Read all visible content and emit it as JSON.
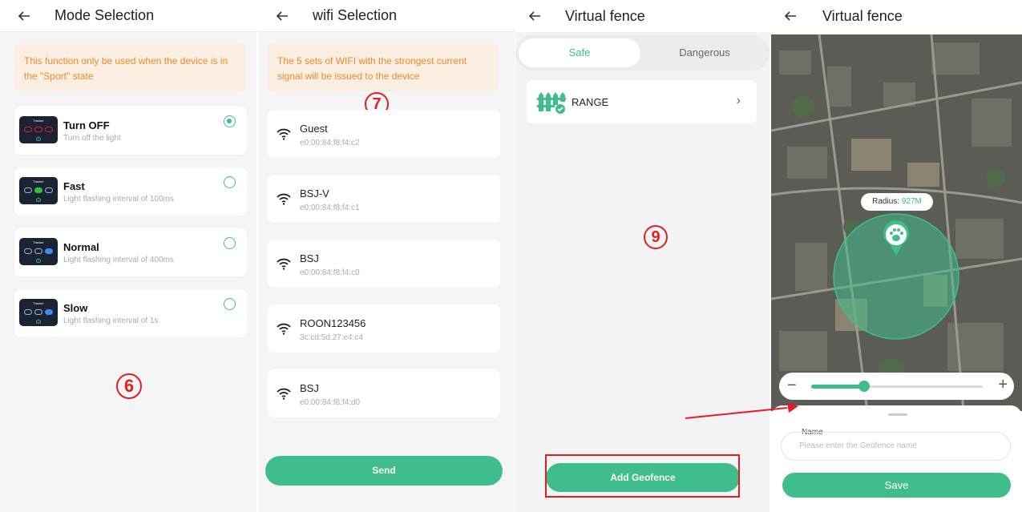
{
  "panel1": {
    "title": "Mode Selection",
    "notice": "This function only be used when the device is in the \"Sport\" state",
    "modes": [
      {
        "name": "Turn OFF",
        "desc": "Turn off the light",
        "selected": true,
        "dot_color": "#e02020"
      },
      {
        "name": "Fast",
        "desc": "Light flashing interval of 100ms",
        "selected": false,
        "dot_color": "#3fbd3f"
      },
      {
        "name": "Normal",
        "desc": "Light flashing interval of 400ms",
        "selected": false,
        "dot_color": "#3a8ef0"
      },
      {
        "name": "Slow",
        "desc": "Light flashing interval of 1s",
        "selected": false,
        "dot_color": "#3a8ef0"
      }
    ],
    "thumb_label": "Tracker",
    "marker": "⑥"
  },
  "panel2": {
    "title": "wifi Selection",
    "notice": "The 5 sets of WIFI with the strongest current signal will be issued to the device",
    "marker": "⑦",
    "networks": [
      {
        "name": "Guest",
        "mac": "e0:00:84:f8:f4:c2"
      },
      {
        "name": "BSJ-V",
        "mac": "e0:00:84:f8:f4:c1"
      },
      {
        "name": "BSJ",
        "mac": "e0:00:84:f8:f4:c0"
      },
      {
        "name": "ROON123456",
        "mac": "3c:cd:5d:27:e4:c4"
      },
      {
        "name": "BSJ",
        "mac": "e0:00:84:f8:f4:d0"
      }
    ],
    "send_label": "Send"
  },
  "panel3": {
    "title": "Virtual fence",
    "tab_safe": "Safe",
    "tab_dangerous": "Dangerous",
    "range_label": "RANGE",
    "marker": "⑨",
    "add_label": "Add Geofence"
  },
  "panel4": {
    "title": "Virtual fence",
    "radius_label": "Radius:",
    "radius_value": "927M",
    "name_label": "Name",
    "name_placeholder": "Please enter the Geofence name",
    "save_label": "Save",
    "slider_level": 0.31
  },
  "colors": {
    "accent": "#3fbd8c",
    "notice_text": "#f08a28",
    "marker_red": "#e02020"
  }
}
